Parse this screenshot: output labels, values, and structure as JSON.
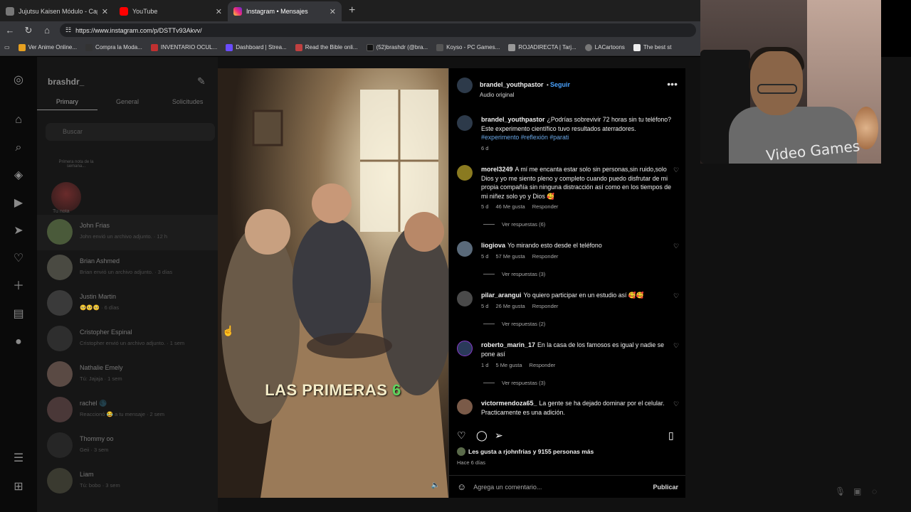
{
  "browser": {
    "tabs": [
      {
        "title": "Jujutsu Kaisen Módulo - Capítulo",
        "color": "#888888"
      },
      {
        "title": "YouTube",
        "color": "#ff0000"
      },
      {
        "title": "Instagram • Mensajes",
        "color": "#d62976"
      }
    ],
    "new_tab": "+",
    "url": "https://www.instagram.com/p/DSTTv93Akvv/",
    "bookmarks": [
      {
        "label": "Ver Anime Online...",
        "color": "#e6a020"
      },
      {
        "label": "Compra la Moda...",
        "color": "#222222"
      },
      {
        "label": "INVENTARIO OCUL...",
        "color": "#c03030"
      },
      {
        "label": "Dashboard | Strea...",
        "color": "#6a4cff"
      },
      {
        "label": "Read the Bible onli...",
        "color": "#c04040"
      },
      {
        "label": "(52)brashdr (@bra...",
        "color": "#111111"
      },
      {
        "label": "Koyso - PC Games...",
        "color": "#555555"
      },
      {
        "label": "ROJADIRECTA | Tarj...",
        "color": "#999999"
      },
      {
        "label": "LACartoons",
        "color": "#777777"
      },
      {
        "label": "The best st",
        "color": "#eeeeee"
      }
    ]
  },
  "inbox": {
    "username": "brashdr_",
    "tabs": [
      "Primary",
      "General",
      "Solicitudes"
    ],
    "search_placeholder": "Buscar",
    "note_text": "Primera nota de la semana...",
    "note_label": "Tu nota",
    "conversations": [
      {
        "name": "John Frias",
        "preview": "John envió un archivo adjunto. · 12 h"
      },
      {
        "name": "Brian Ashmed",
        "preview": "Brian envió un archivo adjunto. · 3 días"
      },
      {
        "name": "Justin Martin",
        "preview": "🥺🥺🥺 · 6 días"
      },
      {
        "name": "Cristopher Espinal",
        "preview": "Cristopher envió un archivo adjunto. · 1 sem"
      },
      {
        "name": "Nathalie Emely",
        "preview": "Tú: Jajaja · 1 sem"
      },
      {
        "name": "rachel 🌑",
        "preview": "Reaccionó 😂 a tu mensaje · 2 sem"
      },
      {
        "name": "Thommy oo",
        "preview": "Geii · 3 sem"
      },
      {
        "name": "Liam",
        "preview": "Tú: bobo · 3 sem"
      }
    ]
  },
  "reel": {
    "caption_words": "LAS PRIMERAS ",
    "caption_number": "6"
  },
  "post": {
    "author": "brandel_youthpastor",
    "follow": "Seguir",
    "audio": "Audio original",
    "caption_author": "brandel_youthpastor",
    "caption": "¿Podrías sobrevivir 72 horas sin tu teléfono? Este experimento científico tuvo resultados aterradores.",
    "hashtags": "#experimento #reflexión #parati",
    "caption_age": "6 d",
    "comments": [
      {
        "user": "morel3249",
        "text": "A mí me encanta estar solo sin personas,sin ruido,solo Dios y yo me siento pleno y completo cuando puedo disfrutar de mi propia compañía sin ninguna distracción así como en los tiempos de mi niñez solo yo y Dios 🥰",
        "age": "5 d",
        "likes": "46 Me gusta",
        "reply": "Responder",
        "view_replies": "Ver respuestas (6)"
      },
      {
        "user": "liogiova",
        "text": "Yo mirando esto desde el teléfono",
        "age": "5 d",
        "likes": "57 Me gusta",
        "reply": "Responder",
        "view_replies": "Ver respuestas (3)"
      },
      {
        "user": "pilar_arangui",
        "text": "Yo quiero participar en un estudio así 🥰🥰",
        "age": "5 d",
        "likes": "26 Me gusta",
        "reply": "Responder",
        "view_replies": "Ver respuestas (2)"
      },
      {
        "user": "roberto_marin_17",
        "text": "En la casa de los famosos es igual y nadie se pone así",
        "age": "1 d",
        "likes": "5 Me gusta",
        "reply": "Responder",
        "view_replies": "Ver respuestas (3)"
      },
      {
        "user": "victormendoza65_",
        "text": "La gente se ha dejado dominar por el celular. Practicamente es una adición.",
        "age": "",
        "likes": "",
        "reply": "",
        "view_replies": ""
      }
    ],
    "liked_by": "Les gusta a rjohnfrias y 9155 personas más",
    "posted_ago": "Hace 6 días",
    "comment_placeholder": "Agrega un comentario...",
    "publish": "Publicar"
  },
  "webcam": {
    "shirt_text": "Video Games"
  }
}
